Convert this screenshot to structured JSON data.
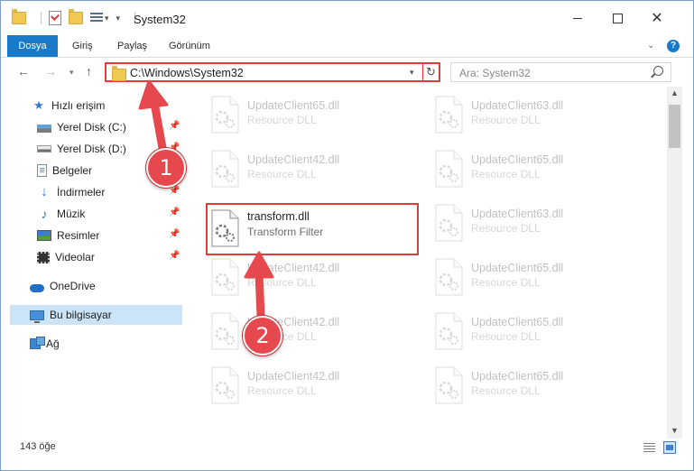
{
  "window": {
    "title": "System32",
    "controls": [
      "minimize-icon",
      "maximize-icon",
      "close-icon"
    ]
  },
  "ribbon": {
    "tabs": [
      "Dosya",
      "Giriş",
      "Paylaş",
      "Görünüm"
    ],
    "help_label": "?"
  },
  "navbar": {
    "address": "C:\\Windows\\System32",
    "search_placeholder": "Ara: System32"
  },
  "sidebar": {
    "items": [
      {
        "label": "Hızlı erişim",
        "icon": "star-icon",
        "pinned": false
      },
      {
        "label": "Yerel Disk (C:)",
        "icon": "drive-icon",
        "pinned": true
      },
      {
        "label": "Yerel Disk (D:)",
        "icon": "drive-icon",
        "pinned": true
      },
      {
        "label": "Belgeler",
        "icon": "document-icon",
        "pinned": true
      },
      {
        "label": "İndirmeler",
        "icon": "download-icon",
        "pinned": true
      },
      {
        "label": "Müzik",
        "icon": "music-icon",
        "pinned": true
      },
      {
        "label": "Resimler",
        "icon": "pictures-icon",
        "pinned": true
      },
      {
        "label": "Videolar",
        "icon": "videos-icon",
        "pinned": true
      },
      {
        "label": "OneDrive",
        "icon": "cloud-icon",
        "pinned": false
      },
      {
        "label": "Bu bilgisayar",
        "icon": "computer-icon",
        "pinned": false,
        "selected": true
      },
      {
        "label": "Ağ",
        "icon": "network-icon",
        "pinned": false
      }
    ]
  },
  "files": [
    {
      "name": "UpdateClient65.dll",
      "type": "Resource DLL",
      "faded": true
    },
    {
      "name": "UpdateClient63.dll",
      "type": "Resource DLL",
      "faded": true
    },
    {
      "name": "UpdateClient42.dll",
      "type": "Resource DLL",
      "faded": true
    },
    {
      "name": "UpdateClient65.dll",
      "type": "Resource DLL",
      "faded": true
    },
    {
      "name": "transform.dll",
      "type": "Transform Filter",
      "faded": false,
      "highlighted": true
    },
    {
      "name": "UpdateClient63.dll",
      "type": "Resource DLL",
      "faded": true
    },
    {
      "name": "UpdateClient42.dll",
      "type": "Resource DLL",
      "faded": true
    },
    {
      "name": "UpdateClient65.dll",
      "type": "Resource DLL",
      "faded": true
    },
    {
      "name": "UpdateClient42.dll",
      "type": "Resource DLL",
      "faded": true
    },
    {
      "name": "UpdateClient65.dll",
      "type": "Resource DLL",
      "faded": true
    },
    {
      "name": "UpdateClient42.dll",
      "type": "Resource DLL",
      "faded": true
    },
    {
      "name": "UpdateClient65.dll",
      "type": "Resource DLL",
      "faded": true
    }
  ],
  "status": {
    "item_count": "143 öğe"
  },
  "annotations": {
    "step1": "1",
    "step2": "2",
    "highlight_color": "#e03c3c",
    "badge_color": "#e5484d"
  },
  "colors": {
    "accent": "#1979ca",
    "selection": "#cce4f7"
  }
}
